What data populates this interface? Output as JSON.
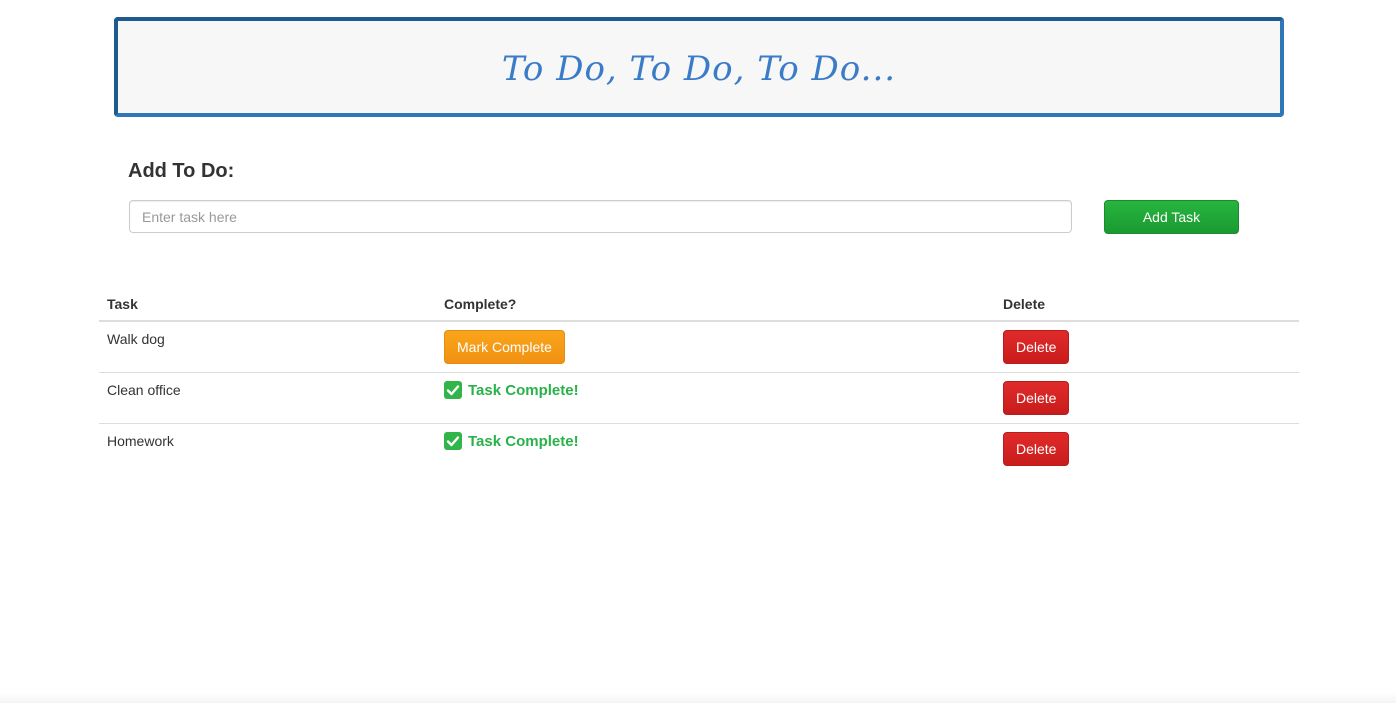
{
  "header": {
    "title": "To Do, To Do, To Do..."
  },
  "add_form": {
    "heading": "Add To Do:",
    "input_placeholder": "Enter task here",
    "input_value": "",
    "add_button_label": "Add Task"
  },
  "table": {
    "columns": [
      "Task",
      "Complete?",
      "Delete"
    ],
    "rows": [
      {
        "task": "Walk dog",
        "status": "incomplete",
        "action_label": "Mark Complete",
        "delete_label": "Delete"
      },
      {
        "task": "Clean office",
        "status": "complete",
        "complete_text": "Task Complete!",
        "delete_label": "Delete"
      },
      {
        "task": "Homework",
        "status": "complete",
        "complete_text": "Task Complete!",
        "delete_label": "Delete"
      }
    ]
  },
  "icons": {
    "complete_icon": "check-box-icon"
  },
  "colors": {
    "banner_border": "#2f77b8",
    "title": "#3a7cc7",
    "add_button": "#1fa637",
    "mark_complete_button": "#f5a015",
    "delete_button": "#d62222",
    "complete_text": "#2ab24a"
  }
}
